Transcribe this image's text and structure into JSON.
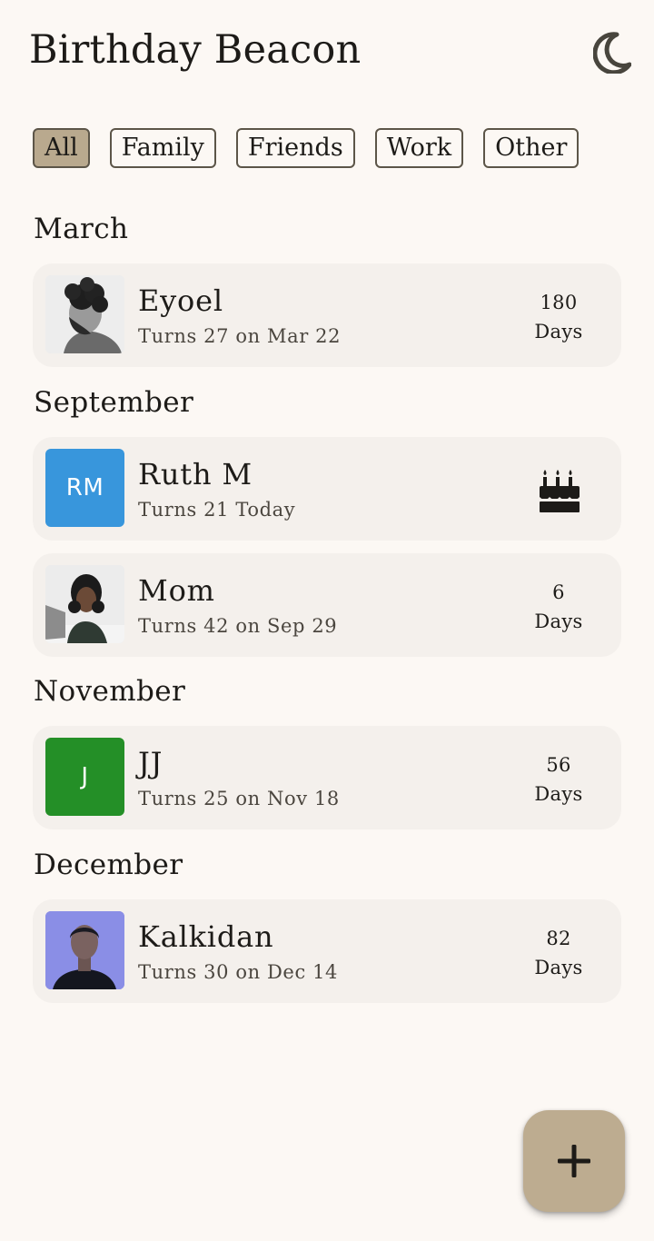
{
  "app": {
    "title": "Birthday Beacon",
    "theme_icon": "moon-icon"
  },
  "filters": [
    {
      "label": "All",
      "selected": true
    },
    {
      "label": "Family",
      "selected": false
    },
    {
      "label": "Friends",
      "selected": false
    },
    {
      "label": "Work",
      "selected": false
    },
    {
      "label": "Other",
      "selected": false
    }
  ],
  "sections": [
    {
      "title": "March"
    },
    {
      "title": "September"
    },
    {
      "title": "November"
    },
    {
      "title": "December"
    }
  ],
  "people": [
    {
      "name": "Eyoel",
      "subtitle": "Turns 27 on Mar 22",
      "days": "180",
      "days_label": "Days",
      "avatar": "photo"
    },
    {
      "name": "Ruth M",
      "subtitle": "Turns 21 Today",
      "initials": "RM",
      "avatar_color": "#3896dc",
      "today_icon": "cake-icon"
    },
    {
      "name": "Mom",
      "subtitle": "Turns 42 on Sep 29",
      "days": "6",
      "days_label": "Days",
      "avatar": "photo"
    },
    {
      "name": "JJ",
      "subtitle": "Turns 25 on Nov 18",
      "initials": "J",
      "avatar_color": "#248f27",
      "days": "56",
      "days_label": "Days"
    },
    {
      "name": "Kalkidan",
      "subtitle": "Turns 30 on Dec 14",
      "days": "82",
      "days_label": "Days",
      "avatar": "photo"
    }
  ],
  "fab": {
    "icon": "plus-icon"
  },
  "colors": {
    "background": "#fcf8f4",
    "card": "#f4f0ec",
    "chip_selected": "#b9a98e",
    "fab": "#bdac90"
  }
}
